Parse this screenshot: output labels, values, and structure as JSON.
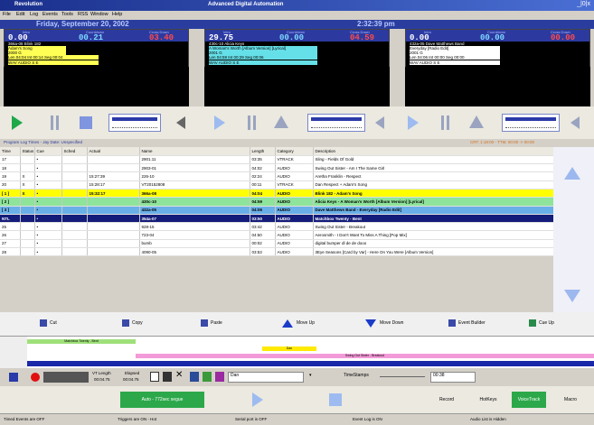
{
  "window": {
    "app": "Revolution",
    "title": "Advanced Digital Automation",
    "controls": "_|0|x"
  },
  "menu": [
    "File",
    "Edit",
    "Log",
    "Events",
    "Tools",
    "RSS",
    "Window",
    "Help"
  ],
  "header": {
    "date": "Friday, September 20, 2002",
    "time": "2:32:39 pm"
  },
  "players": [
    {
      "intro_label": "Intro",
      "countdown_label": "Countdown",
      "crossdown_label": "Cross Down",
      "intro": "0.00",
      "countdown": "00.21",
      "crossdown": "03.40",
      "lines": [
        "366a-08 Blink 182",
        "Adam's Song",
        "2000  G",
        "Len 04:04  Int 00:14   Seg 00:04",
        "WAV  AUDIO  S        E"
      ],
      "info_bg": "#ffff55"
    },
    {
      "intro_label": "Intro",
      "countdown_label": "Countdown",
      "crossdown_label": "Cross Down",
      "intro": "29.75",
      "countdown": "00.00",
      "crossdown": "04.59",
      "lines": [
        "430c-10 Alicia Keys",
        "A Woman's Worth [Album Version] [Lyrical]",
        "2001  G",
        "Len 04:59  Int 00:29   Seg 00:06",
        "WAV  AUDIO  S        E"
      ],
      "info_bg": "#66e0e8"
    },
    {
      "intro_label": "Intro",
      "countdown_label": "Countdown",
      "crossdown_label": "Cross Down",
      "intro": "0.00",
      "countdown": "00.00",
      "crossdown": "00.00",
      "lines": [
        "432a-05 Dave Matthews Band",
        "Everyday [Radio Edit]",
        "2001  G",
        "Len 04:06  Int 00:00   Seg 00:00",
        "WAV  AUDIO  S        E"
      ],
      "info_bg": "#ffffff"
    }
  ],
  "log_bar": {
    "left": "Program Log Times  -  Jay Date: Unspecified",
    "right": "CRT: 1:18:00 - TTM: 00:00 -> 00:00"
  },
  "log": {
    "columns": [
      "Time",
      "Status",
      "Cue",
      "Sched",
      "Actual",
      "Name",
      "Length",
      "Category",
      "Description"
    ],
    "rows": [
      {
        "time": "17",
        "status": "",
        "cue": "•",
        "sched": "",
        "actual": "",
        "name": "2901.11",
        "length": "03:35",
        "cat": "VTRACK",
        "desc": "Sling - Fields Of Gold",
        "cls": "norm"
      },
      {
        "time": "18",
        "status": "",
        "cue": "•",
        "sched": "",
        "actual": "",
        "name": "2903-01",
        "length": "04:02",
        "cat": "AUDIO",
        "desc": "Swing Out Sister - Am I The Same Girl",
        "cls": "norm"
      },
      {
        "time": "19",
        "status": "X",
        "cue": "•",
        "sched": "",
        "actual": "15:27:39",
        "name": "226-10",
        "length": "02:24",
        "cat": "AUDIO",
        "desc": "Aretha Franklin - Respect",
        "cls": "norm"
      },
      {
        "time": "20",
        "status": "X",
        "cue": "•",
        "sched": "",
        "actual": "15:28:17",
        "name": "VT20152808",
        "length": "00:11",
        "cat": "VTRACK",
        "desc": "Dan   Respect + Adam's Song",
        "cls": "norm"
      },
      {
        "time": "[ 1 ]",
        "status": "X",
        "cue": "•",
        "sched": "",
        "actual": "15:32:17",
        "name": "366a-08",
        "length": "04:04",
        "cat": "AUDIO",
        "desc": "Blink 182 - Adam's Song",
        "cls": "cur"
      },
      {
        "time": "[ 2 ]",
        "status": "",
        "cue": "•",
        "sched": "",
        "actual": "",
        "name": "430c-10",
        "length": "04:59",
        "cat": "AUDIO",
        "desc": "Alicia Keys - A Woman's Worth [Album Version] [Lyrical]",
        "cls": "next1"
      },
      {
        "time": "[ 3 ]",
        "status": "",
        "cue": "•",
        "sched": "",
        "actual": "",
        "name": "432a-05",
        "length": "04:06",
        "cat": "AUDIO",
        "desc": "Dave Matthews Band - Everyday [Radio Edit]",
        "cls": "next3"
      },
      {
        "time": "NTL",
        "status": "",
        "cue": "•",
        "sched": "",
        "actual": "",
        "name": "354a-07",
        "length": "03:50",
        "cat": "AUDIO",
        "desc": "Matchbox Twenty - Bent",
        "cls": "sel"
      },
      {
        "time": "25",
        "status": "",
        "cue": "•",
        "sched": "",
        "actual": "",
        "name": "928-15",
        "length": "03:42",
        "cat": "AUDIO",
        "desc": "Swing Out Sister - Breakout",
        "cls": "norm"
      },
      {
        "time": "26",
        "status": "",
        "cue": "•",
        "sched": "",
        "actual": "",
        "name": "723-04",
        "length": "04:50",
        "cat": "AUDIO",
        "desc": "Aerosmith - I Don't Want To Miss A Thing [Pop Mix]",
        "cls": "norm"
      },
      {
        "time": "27",
        "status": "",
        "cue": "•",
        "sched": "",
        "actual": "",
        "name": "bumb",
        "length": "00:02",
        "cat": "AUDIO",
        "desc": "digital bumper   dl de de dooo",
        "cls": "norm"
      },
      {
        "time": "28",
        "status": "",
        "cue": "•",
        "sched": "",
        "actual": "",
        "name": "4090-05",
        "length": "03:53",
        "cat": "AUDIO",
        "desc": "3Eye Seasons [Card by Var] - Here On You Were [Album Version]",
        "cls": "norm"
      }
    ]
  },
  "actions": {
    "cut": "Cut",
    "copy": "Copy",
    "paste": "Paste",
    "move_up": "Move Up",
    "move_down": "Move Down",
    "event_builder": "Event Builder",
    "cue_up": "Cue Up"
  },
  "timeline": {
    "a": "Matchbox Twenty - Bent",
    "b": "Dan",
    "c": "Swing Out Sister - Breakout"
  },
  "toolbar2": {
    "vt_length": "VT Length",
    "vt_length_val": "00:04.75",
    "elapsed": "Elapsed",
    "elapsed_val": "00:04.75",
    "user": "Dan",
    "timestamp_label": "TimeStamps",
    "time_field": "00:38"
  },
  "bottom": {
    "auto": "Auto - 772sec segue",
    "record": "Record",
    "hotkeys": "HotKeys",
    "voice_track": "VoiceTrack",
    "macro": "Macro"
  },
  "status": {
    "timed_events": "Timed Events are OFF",
    "triggers": "Triggers are ON - Hot",
    "serial": "Serial port is OFF",
    "event_log": "Event Log is ON",
    "audio_list": "Audio List is Hidden"
  }
}
